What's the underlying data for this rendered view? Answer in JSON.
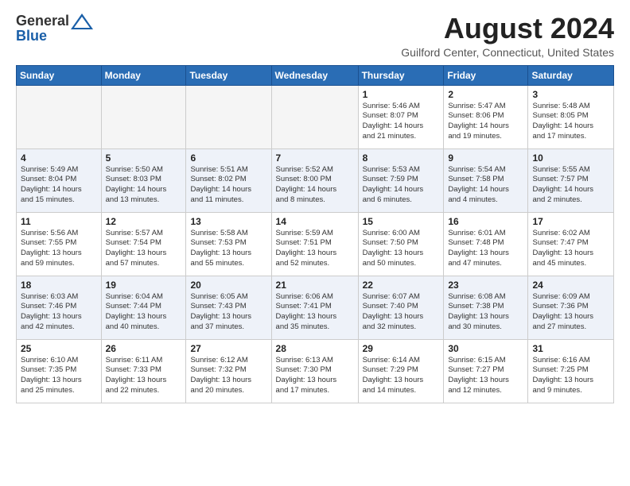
{
  "header": {
    "logo_general": "General",
    "logo_blue": "Blue",
    "month_title": "August 2024",
    "location": "Guilford Center, Connecticut, United States"
  },
  "weekdays": [
    "Sunday",
    "Monday",
    "Tuesday",
    "Wednesday",
    "Thursday",
    "Friday",
    "Saturday"
  ],
  "weeks": [
    [
      {
        "day": "",
        "info": ""
      },
      {
        "day": "",
        "info": ""
      },
      {
        "day": "",
        "info": ""
      },
      {
        "day": "",
        "info": ""
      },
      {
        "day": "1",
        "info": "Sunrise: 5:46 AM\nSunset: 8:07 PM\nDaylight: 14 hours\nand 21 minutes."
      },
      {
        "day": "2",
        "info": "Sunrise: 5:47 AM\nSunset: 8:06 PM\nDaylight: 14 hours\nand 19 minutes."
      },
      {
        "day": "3",
        "info": "Sunrise: 5:48 AM\nSunset: 8:05 PM\nDaylight: 14 hours\nand 17 minutes."
      }
    ],
    [
      {
        "day": "4",
        "info": "Sunrise: 5:49 AM\nSunset: 8:04 PM\nDaylight: 14 hours\nand 15 minutes."
      },
      {
        "day": "5",
        "info": "Sunrise: 5:50 AM\nSunset: 8:03 PM\nDaylight: 14 hours\nand 13 minutes."
      },
      {
        "day": "6",
        "info": "Sunrise: 5:51 AM\nSunset: 8:02 PM\nDaylight: 14 hours\nand 11 minutes."
      },
      {
        "day": "7",
        "info": "Sunrise: 5:52 AM\nSunset: 8:00 PM\nDaylight: 14 hours\nand 8 minutes."
      },
      {
        "day": "8",
        "info": "Sunrise: 5:53 AM\nSunset: 7:59 PM\nDaylight: 14 hours\nand 6 minutes."
      },
      {
        "day": "9",
        "info": "Sunrise: 5:54 AM\nSunset: 7:58 PM\nDaylight: 14 hours\nand 4 minutes."
      },
      {
        "day": "10",
        "info": "Sunrise: 5:55 AM\nSunset: 7:57 PM\nDaylight: 14 hours\nand 2 minutes."
      }
    ],
    [
      {
        "day": "11",
        "info": "Sunrise: 5:56 AM\nSunset: 7:55 PM\nDaylight: 13 hours\nand 59 minutes."
      },
      {
        "day": "12",
        "info": "Sunrise: 5:57 AM\nSunset: 7:54 PM\nDaylight: 13 hours\nand 57 minutes."
      },
      {
        "day": "13",
        "info": "Sunrise: 5:58 AM\nSunset: 7:53 PM\nDaylight: 13 hours\nand 55 minutes."
      },
      {
        "day": "14",
        "info": "Sunrise: 5:59 AM\nSunset: 7:51 PM\nDaylight: 13 hours\nand 52 minutes."
      },
      {
        "day": "15",
        "info": "Sunrise: 6:00 AM\nSunset: 7:50 PM\nDaylight: 13 hours\nand 50 minutes."
      },
      {
        "day": "16",
        "info": "Sunrise: 6:01 AM\nSunset: 7:48 PM\nDaylight: 13 hours\nand 47 minutes."
      },
      {
        "day": "17",
        "info": "Sunrise: 6:02 AM\nSunset: 7:47 PM\nDaylight: 13 hours\nand 45 minutes."
      }
    ],
    [
      {
        "day": "18",
        "info": "Sunrise: 6:03 AM\nSunset: 7:46 PM\nDaylight: 13 hours\nand 42 minutes."
      },
      {
        "day": "19",
        "info": "Sunrise: 6:04 AM\nSunset: 7:44 PM\nDaylight: 13 hours\nand 40 minutes."
      },
      {
        "day": "20",
        "info": "Sunrise: 6:05 AM\nSunset: 7:43 PM\nDaylight: 13 hours\nand 37 minutes."
      },
      {
        "day": "21",
        "info": "Sunrise: 6:06 AM\nSunset: 7:41 PM\nDaylight: 13 hours\nand 35 minutes."
      },
      {
        "day": "22",
        "info": "Sunrise: 6:07 AM\nSunset: 7:40 PM\nDaylight: 13 hours\nand 32 minutes."
      },
      {
        "day": "23",
        "info": "Sunrise: 6:08 AM\nSunset: 7:38 PM\nDaylight: 13 hours\nand 30 minutes."
      },
      {
        "day": "24",
        "info": "Sunrise: 6:09 AM\nSunset: 7:36 PM\nDaylight: 13 hours\nand 27 minutes."
      }
    ],
    [
      {
        "day": "25",
        "info": "Sunrise: 6:10 AM\nSunset: 7:35 PM\nDaylight: 13 hours\nand 25 minutes."
      },
      {
        "day": "26",
        "info": "Sunrise: 6:11 AM\nSunset: 7:33 PM\nDaylight: 13 hours\nand 22 minutes."
      },
      {
        "day": "27",
        "info": "Sunrise: 6:12 AM\nSunset: 7:32 PM\nDaylight: 13 hours\nand 20 minutes."
      },
      {
        "day": "28",
        "info": "Sunrise: 6:13 AM\nSunset: 7:30 PM\nDaylight: 13 hours\nand 17 minutes."
      },
      {
        "day": "29",
        "info": "Sunrise: 6:14 AM\nSunset: 7:29 PM\nDaylight: 13 hours\nand 14 minutes."
      },
      {
        "day": "30",
        "info": "Sunrise: 6:15 AM\nSunset: 7:27 PM\nDaylight: 13 hours\nand 12 minutes."
      },
      {
        "day": "31",
        "info": "Sunrise: 6:16 AM\nSunset: 7:25 PM\nDaylight: 13 hours\nand 9 minutes."
      }
    ]
  ]
}
